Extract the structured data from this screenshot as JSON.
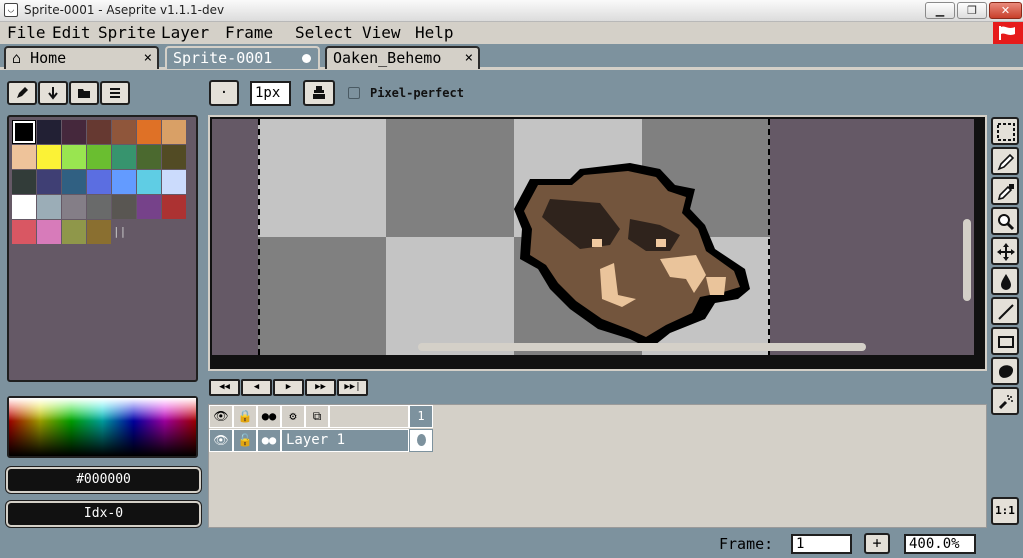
{
  "window": {
    "title": "Sprite-0001 - Aseprite v1.1.1-dev",
    "minimize": "▁",
    "maximize": "❐",
    "close": "✕"
  },
  "menu": [
    "File",
    "Edit",
    "Sprite",
    "Layer",
    "Frame",
    "Select",
    "View",
    "Help"
  ],
  "tabs": [
    {
      "label": "Home",
      "close": "×"
    },
    {
      "label": "Sprite-0001"
    },
    {
      "label": "Oaken_Behemo",
      "close": "×"
    }
  ],
  "toolbar": {
    "brush_size": "1px",
    "pixel_perfect_label": "Pixel-perfect",
    "brush_type_label": "·"
  },
  "palette": {
    "colors": [
      "#000000",
      "#222034",
      "#45283c",
      "#663931",
      "#8f563b",
      "#df7126",
      "#d9a066",
      "#eec39a",
      "#fbf236",
      "#99e550",
      "#6abe30",
      "#37946e",
      "#4b692f",
      "#524b24",
      "#323c39",
      "#3f3f74",
      "#306082",
      "#5b6ee1",
      "#639bff",
      "#5fcde4",
      "#cbdbfc",
      "#ffffff",
      "#9badb7",
      "#847e87",
      "#696a6a",
      "#595652",
      "#76428a",
      "#ac3232",
      "#d95763",
      "#d77bba",
      "#8f974a",
      "#8a6f30"
    ]
  },
  "color_info": {
    "hex": "#000000",
    "index": "Idx-0"
  },
  "timeline": {
    "header_frame": "1",
    "layers": [
      {
        "name": "Layer 1"
      }
    ]
  },
  "status": {
    "frame_label": "Frame:",
    "frame_value": "1",
    "add_frame": "+",
    "zoom": "400.0%"
  },
  "actual_size_label": "1:1"
}
